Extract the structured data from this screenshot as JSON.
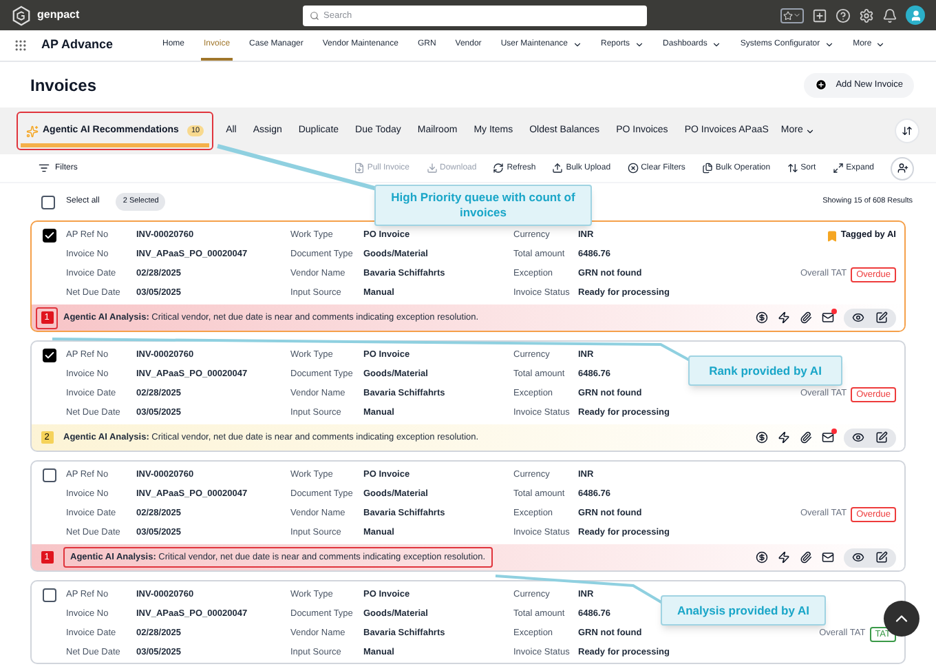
{
  "header": {
    "brand": "genpact",
    "search": {
      "placeholder": "Search"
    }
  },
  "nav": {
    "app_title": "AP Advance",
    "items": [
      {
        "label": "Home",
        "selected": false,
        "dropdown": false
      },
      {
        "label": "Invoice",
        "selected": true,
        "dropdown": false
      },
      {
        "label": "Case Manager",
        "selected": false,
        "dropdown": false
      },
      {
        "label": "Vendor Maintenance",
        "selected": false,
        "dropdown": false
      },
      {
        "label": "GRN",
        "selected": false,
        "dropdown": false
      },
      {
        "label": "Vendor",
        "selected": false,
        "dropdown": false
      },
      {
        "label": "User Maintenance",
        "selected": false,
        "dropdown": true
      },
      {
        "label": "Reports",
        "selected": false,
        "dropdown": true
      },
      {
        "label": "Dashboards",
        "selected": false,
        "dropdown": true
      },
      {
        "label": "Systems Configurator",
        "selected": false,
        "dropdown": true
      },
      {
        "label": "More",
        "selected": false,
        "dropdown": true
      }
    ]
  },
  "page_title": "Invoices",
  "add_button": "Add New Invoice",
  "tabs": [
    {
      "label": "Agentic AI Recommendations",
      "count": "10",
      "kind": "ai",
      "selected": true,
      "highlighted": true
    },
    {
      "label": "All",
      "kind": "plain",
      "selected": false,
      "highlighted": false
    },
    {
      "label": "Assign",
      "kind": "plain",
      "selected": false,
      "highlighted": false
    },
    {
      "label": "Duplicate",
      "kind": "plain",
      "selected": false,
      "highlighted": false
    },
    {
      "label": "Due Today",
      "kind": "plain",
      "selected": false,
      "highlighted": false
    },
    {
      "label": "Mailroom",
      "kind": "plain",
      "selected": false,
      "highlighted": false
    },
    {
      "label": "My Items",
      "kind": "plain",
      "selected": false,
      "highlighted": false
    },
    {
      "label": "Oldest Balances",
      "kind": "plain",
      "selected": false,
      "highlighted": false
    },
    {
      "label": "PO Invoices",
      "kind": "plain",
      "selected": false,
      "highlighted": false
    },
    {
      "label": "PO Invoices APaaS",
      "kind": "plain",
      "selected": false,
      "highlighted": false
    }
  ],
  "tabs_more": "More",
  "toolbar": {
    "filters": "Filters",
    "actions": [
      {
        "label": "Pull Invoice",
        "kind": "pull",
        "disabled": true
      },
      {
        "label": "Download",
        "kind": "download",
        "disabled": true
      },
      {
        "label": "Refresh",
        "kind": "refresh",
        "disabled": false
      },
      {
        "label": "Bulk Upload",
        "kind": "upload",
        "disabled": false
      },
      {
        "label": "Clear Filters",
        "kind": "clear",
        "disabled": false
      },
      {
        "label": "Bulk Operation",
        "kind": "bulk",
        "disabled": false
      },
      {
        "label": "Sort",
        "kind": "sort",
        "disabled": false
      },
      {
        "label": "Expand",
        "kind": "expand",
        "disabled": false
      }
    ]
  },
  "select_all": {
    "label": "Select all",
    "checked": false
  },
  "selected_count": "2 Selected",
  "results": "Showing 15 of 608 Results",
  "cards": [
    {
      "checked": true,
      "highlighted": true,
      "tag": "Tagged by AI",
      "fields": [
        {
          "label": "AP Ref No",
          "value": "INV-00020760"
        },
        {
          "label": "Invoice No",
          "value": "INV_APaaS_PO_00020047"
        },
        {
          "label": "Invoice Date",
          "value": "02/28/2025"
        },
        {
          "label": "Net Due Date",
          "value": "03/05/2025"
        },
        {
          "label": "Work Type",
          "value": "PO Invoice"
        },
        {
          "label": "Document Type",
          "value": "Goods/Material"
        },
        {
          "label": "Vendor Name",
          "value": "Bavaria Schiffahrts"
        },
        {
          "label": "Input Source",
          "value": "Manual"
        },
        {
          "label": "Currency",
          "value": "INR"
        },
        {
          "label": "Total amount",
          "value": "6486.76"
        },
        {
          "label": "Exception",
          "value": "GRN not found"
        },
        {
          "label": "Invoice Status",
          "value": "Ready for processing"
        }
      ],
      "tat": {
        "label": "Overall TAT",
        "status": "Overdue",
        "color": "#ee3b3b"
      },
      "mail_badge": true,
      "analysis": {
        "rank": "1",
        "color": "#e0141e",
        "highlighted_rank": true,
        "highlighted_text": false,
        "text": "**Agentic AI Analysis:** Critical vendor, net due date is near and comments indicating exception resolution."
      }
    },
    {
      "checked": true,
      "highlighted": false,
      "fields": [
        {
          "label": "AP Ref No",
          "value": "INV-00020760"
        },
        {
          "label": "Invoice No",
          "value": "INV_APaaS_PO_00020047"
        },
        {
          "label": "Invoice Date",
          "value": "02/28/2025"
        },
        {
          "label": "Net Due Date",
          "value": "03/05/2025"
        },
        {
          "label": "Work Type",
          "value": "PO Invoice"
        },
        {
          "label": "Document Type",
          "value": "Goods/Material"
        },
        {
          "label": "Vendor Name",
          "value": "Bavaria Schiffahrts"
        },
        {
          "label": "Input Source",
          "value": "Manual"
        },
        {
          "label": "Currency",
          "value": "INR"
        },
        {
          "label": "Total amount",
          "value": "6486.76"
        },
        {
          "label": "Exception",
          "value": "GRN not found"
        },
        {
          "label": "Invoice Status",
          "value": "Ready for processing"
        }
      ],
      "tat": {
        "label": "Overall TAT",
        "status": "Overdue",
        "color": "#ee3b3b"
      },
      "mail_badge": true,
      "analysis": {
        "rank": "2",
        "color": "#f5d25a",
        "highlighted_rank": false,
        "highlighted_text": false,
        "text": "**Agentic AI Analysis:** Critical vendor, net due date is near and comments indicating exception resolution."
      }
    },
    {
      "checked": false,
      "highlighted": false,
      "fields": [
        {
          "label": "AP Ref No",
          "value": "INV-00020760"
        },
        {
          "label": "Invoice No",
          "value": "INV_APaaS_PO_00020047"
        },
        {
          "label": "Invoice Date",
          "value": "02/28/2025"
        },
        {
          "label": "Net Due Date",
          "value": "03/05/2025"
        },
        {
          "label": "Work Type",
          "value": "PO Invoice"
        },
        {
          "label": "Document Type",
          "value": "Goods/Material"
        },
        {
          "label": "Vendor Name",
          "value": "Bavaria Schiffahrts"
        },
        {
          "label": "Input Source",
          "value": "Manual"
        },
        {
          "label": "Currency",
          "value": "INR"
        },
        {
          "label": "Total amount",
          "value": "6486.76"
        },
        {
          "label": "Exception",
          "value": "GRN not found"
        },
        {
          "label": "Invoice Status",
          "value": "Ready for processing"
        }
      ],
      "tat": {
        "label": "Overall TAT",
        "status": "Overdue",
        "color": "#ee3b3b"
      },
      "mail_badge": false,
      "analysis": {
        "rank": "1",
        "color": "#e0141e",
        "highlighted_rank": false,
        "highlighted_text": true,
        "text": "**Agentic AI Analysis:** Critical vendor, net due date is near and comments indicating exception resolution."
      }
    },
    {
      "checked": false,
      "highlighted": false,
      "fields": [
        {
          "label": "AP Ref No",
          "value": "INV-00020760"
        },
        {
          "label": "Invoice No",
          "value": "INV_APaaS_PO_00020047"
        },
        {
          "label": "Invoice Date",
          "value": "02/28/2025"
        },
        {
          "label": "Net Due Date",
          "value": "03/05/2025"
        },
        {
          "label": "Work Type",
          "value": "PO Invoice"
        },
        {
          "label": "Document Type",
          "value": "Goods/Material"
        },
        {
          "label": "Vendor Name",
          "value": "Bavaria Schiffahrts"
        },
        {
          "label": "Input Source",
          "value": "Manual"
        },
        {
          "label": "Currency",
          "value": "INR"
        },
        {
          "label": "Total amount",
          "value": "6486.76"
        },
        {
          "label": "Exception",
          "value": "GRN not found"
        },
        {
          "label": "Invoice Status",
          "value": "Ready for processing"
        }
      ],
      "tat": {
        "label": "Overall TAT",
        "status": "TAT",
        "color": "#3a9a48"
      }
    }
  ],
  "annotations": [
    {
      "text": "High Priority queue with count of invoices"
    },
    {
      "text": "Rank provided by AI"
    },
    {
      "text": "Analysis provided by AI"
    }
  ]
}
